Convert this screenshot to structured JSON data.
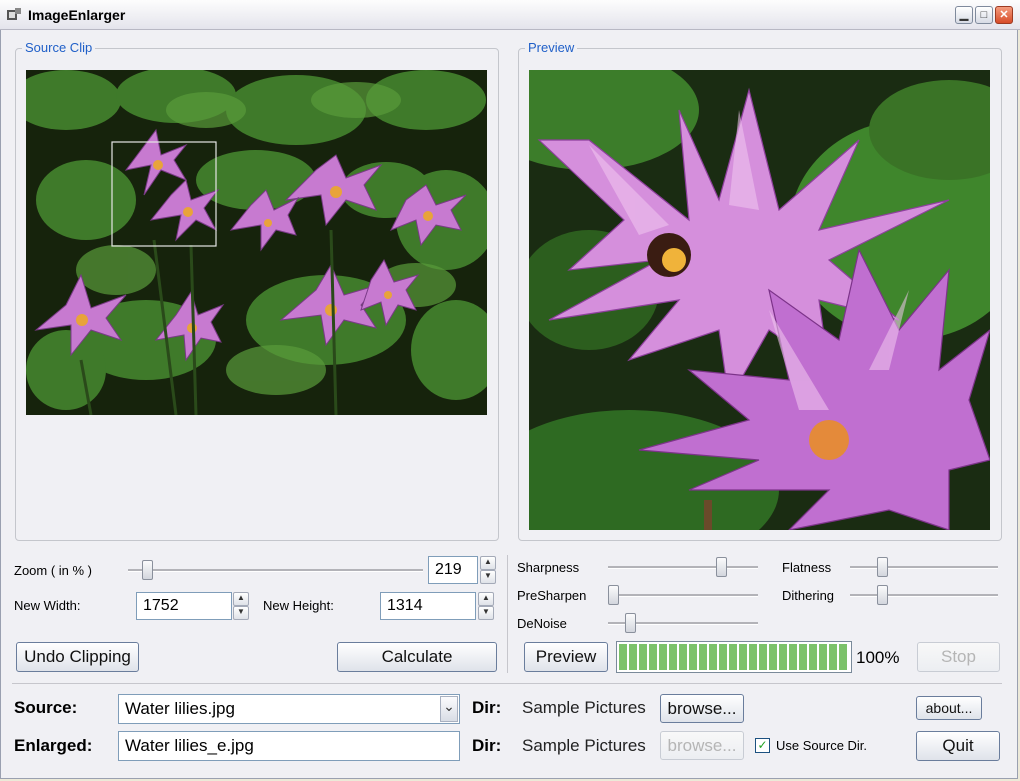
{
  "window": {
    "title": "ImageEnlarger",
    "min_symbol": "▁",
    "max_symbol": "□",
    "close_symbol": "✕"
  },
  "source_clip": {
    "legend": "Source Clip"
  },
  "preview_box": {
    "legend": "Preview"
  },
  "zoom": {
    "label": "Zoom ( in % )",
    "value": "219",
    "slider_fraction": 0.05
  },
  "size": {
    "width_label": "New Width:",
    "width_value": "1752",
    "height_label": "New Height:",
    "height_value": "1314"
  },
  "filters": {
    "sharpness": {
      "label": "Sharpness",
      "level": 0.78
    },
    "presharpen": {
      "label": "PreSharpen",
      "level": 0.0
    },
    "denoise": {
      "label": "DeNoise",
      "level": 0.12
    },
    "flatness": {
      "label": "Flatness",
      "level": 0.2
    },
    "dithering": {
      "label": "Dithering",
      "level": 0.2
    }
  },
  "buttons": {
    "undo_clipping": "Undo Clipping",
    "calculate": "Calculate",
    "preview": "Preview",
    "stop": "Stop",
    "browse_source": "browse...",
    "browse_enlarged": "browse...",
    "about": "about...",
    "quit": "Quit"
  },
  "progress": {
    "percent_text": "100%",
    "fraction": 1.0
  },
  "source": {
    "label": "Source:",
    "file": "Water lilies.jpg",
    "dir_label": "Dir:",
    "dir": "Sample Pictures"
  },
  "enlarged": {
    "label": "Enlarged:",
    "file": "Water lilies_e.jpg",
    "dir_label": "Dir:",
    "dir": "Sample Pictures",
    "use_source_dir_label": "Use Source Dir.",
    "use_source_dir_checked": true
  },
  "icons": {
    "app": "app-icon",
    "dropdown": "chevron-down-icon",
    "spin_up": "▲",
    "spin_down": "▼",
    "check": "✓",
    "dropdown_glyph": "⌄"
  }
}
